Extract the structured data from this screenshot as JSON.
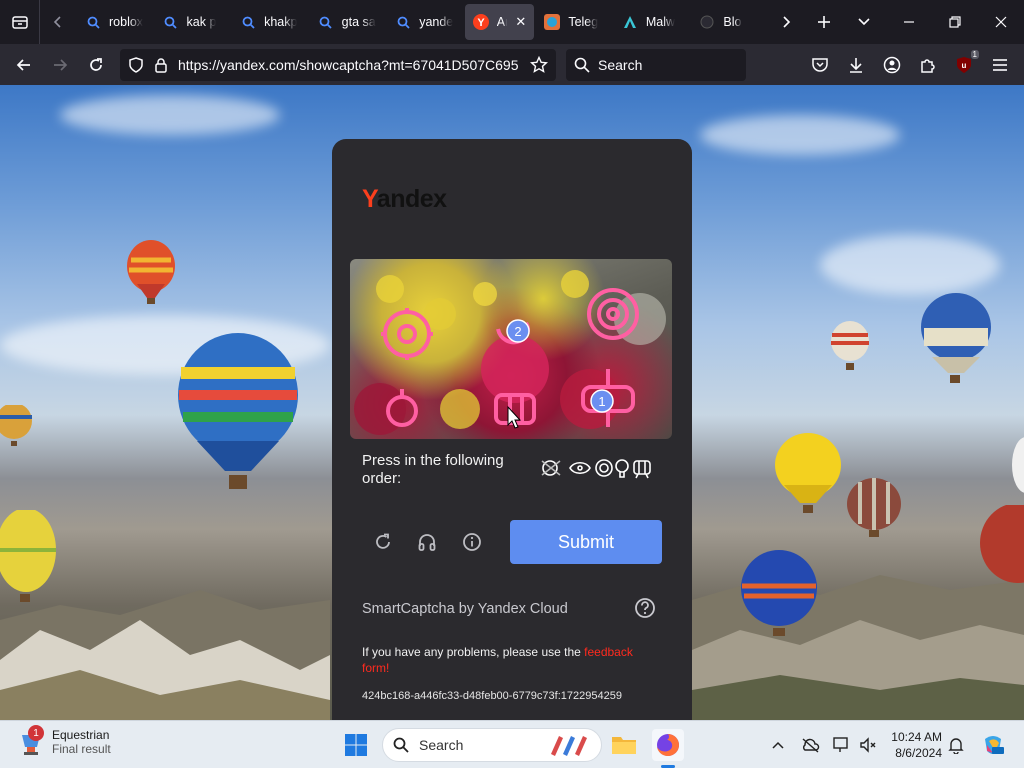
{
  "browser": {
    "tabs": [
      {
        "label": "roblox",
        "icon": "search-icon"
      },
      {
        "label": "kak p",
        "icon": "search-icon"
      },
      {
        "label": "khakp",
        "icon": "search-icon"
      },
      {
        "label": "gta sa",
        "icon": "search-icon"
      },
      {
        "label": "yande",
        "icon": "search-icon"
      },
      {
        "label": "An",
        "icon": "yandex-icon",
        "active": true
      },
      {
        "label": "Teleg",
        "icon": "telegram-icon"
      },
      {
        "label": "Malw",
        "icon": "malwarebytes-icon"
      },
      {
        "label": "Blo",
        "icon": "blog-icon"
      }
    ],
    "url": "https://yandex.com/showcaptcha?mt=67041D507C695",
    "search_placeholder": "Search",
    "extension_badge": "1"
  },
  "captcha": {
    "brand_first": "Y",
    "brand_rest": "andex",
    "instruction": "Press in the following order:",
    "submit_label": "Submit",
    "markers": [
      "2",
      "1"
    ],
    "powered_by": "SmartCaptcha by Yandex Cloud",
    "problems_text": "If you have any problems, please use the ",
    "problems_link": "feedback form!",
    "token": "424bc168-a446fc33-d48feb00-6779c73f:1722954259",
    "accent_color": "#5e8df0",
    "link_color": "#ff2a1f"
  },
  "taskbar": {
    "notification_count": "1",
    "weather_title": "Equestrian",
    "weather_subtitle": "Final result",
    "search_placeholder": "Search",
    "time": "10:24 AM",
    "date": "8/6/2024"
  }
}
